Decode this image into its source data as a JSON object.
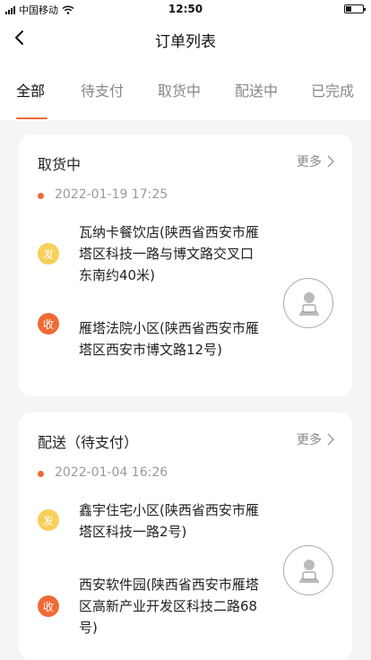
{
  "status_bar": {
    "carrier": "中国移动",
    "time": "12:50"
  },
  "nav": {
    "title": "订单列表"
  },
  "tabs": [
    {
      "label": "全部",
      "active": true
    },
    {
      "label": "待支付",
      "active": false
    },
    {
      "label": "取货中",
      "active": false
    },
    {
      "label": "配送中",
      "active": false
    },
    {
      "label": "已完成",
      "active": false
    }
  ],
  "colors": {
    "accent": "#f06a35",
    "send_badge": "#f8cf59",
    "recv_badge": "#f06a35"
  },
  "orders": [
    {
      "status": "取货中",
      "more_label": "更多",
      "time": "2022-01-19 17:25",
      "send_badge": "发",
      "send_address": "瓦纳卡餐饮店(陕西省西安市雁塔区科技一路与博文路交叉口东南约40米)",
      "recv_badge": "收",
      "recv_address": "雁塔法院小区(陕西省西安市雁塔区西安市博文路12号)"
    },
    {
      "status": "配送（待支付）",
      "more_label": "更多",
      "time": "2022-01-04 16:26",
      "send_badge": "发",
      "send_address": "鑫宇住宅小区(陕西省西安市雁塔区科技一路2号)",
      "recv_badge": "收",
      "recv_address": "西安软件园(陕西省西安市雁塔区高新产业开发区科技二路68号)"
    }
  ]
}
